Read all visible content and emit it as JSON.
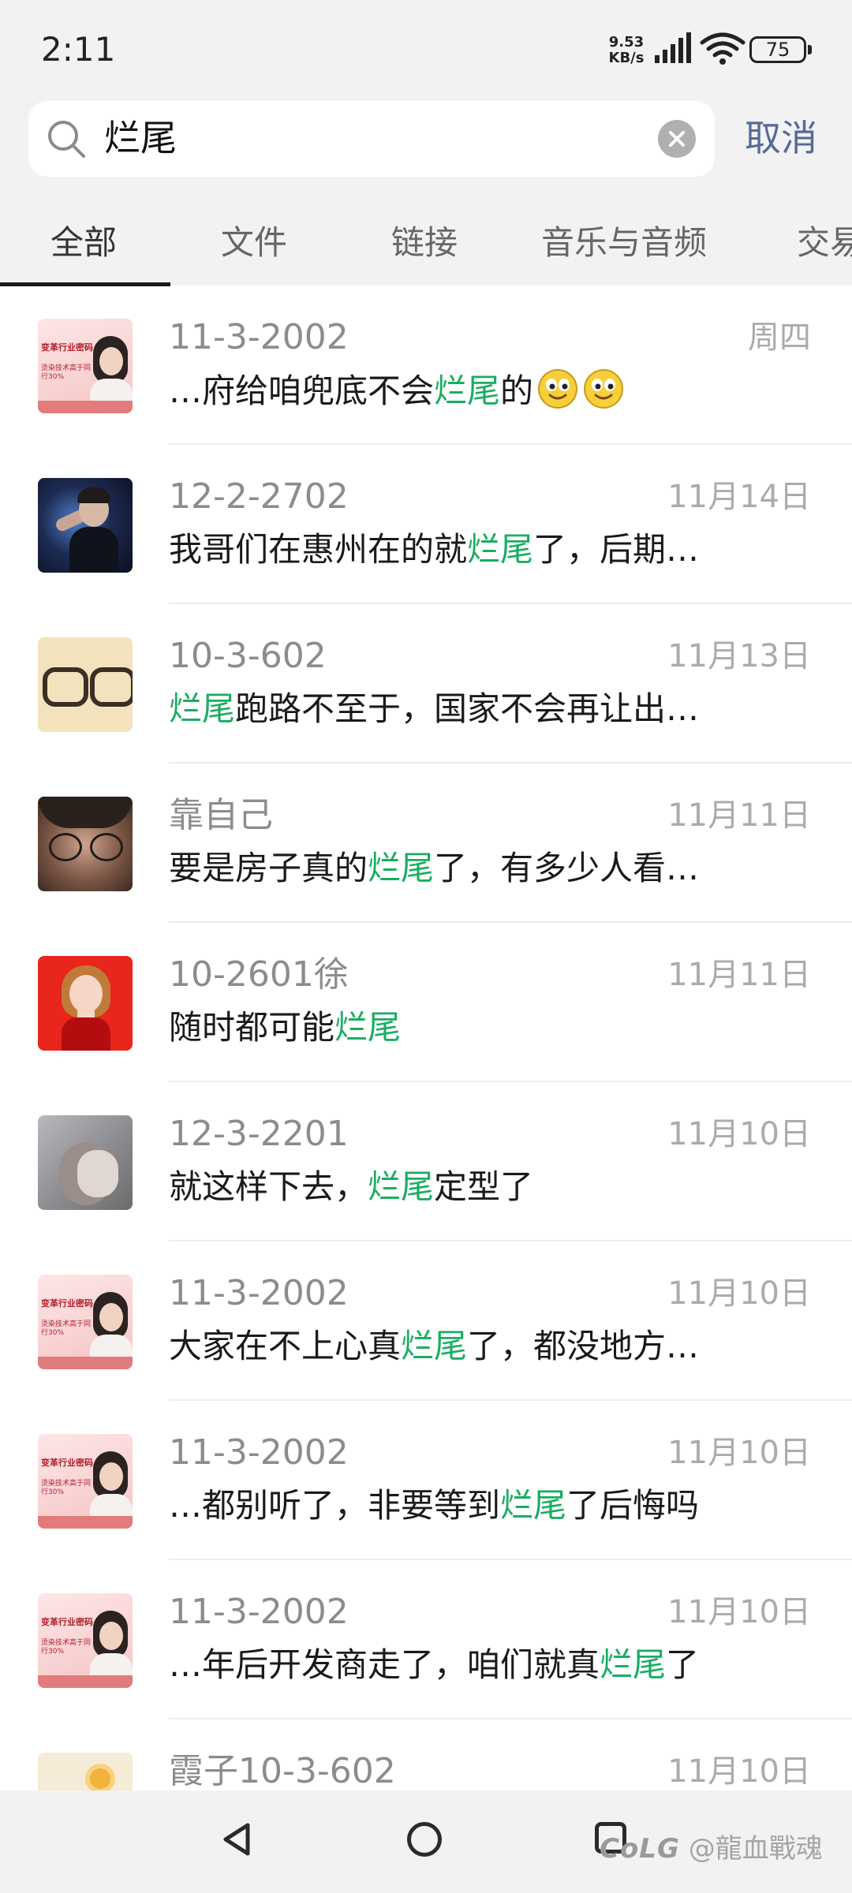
{
  "status_bar": {
    "time": "2:11",
    "network_speed_value": "9.53",
    "network_speed_unit": "KB/s",
    "battery": "75",
    "icons": [
      "signal-icon",
      "wifi-icon",
      "battery-icon"
    ]
  },
  "search": {
    "query": "烂尾",
    "cancel_label": "取消",
    "icons": [
      "search-icon",
      "clear-icon"
    ]
  },
  "tabs": [
    {
      "label": "全部",
      "active": true
    },
    {
      "label": "文件",
      "active": false
    },
    {
      "label": "链接",
      "active": false
    },
    {
      "label": "音乐与音频",
      "active": false
    },
    {
      "label": "交易",
      "active": false
    }
  ],
  "results": [
    {
      "name": "11-3-2002",
      "date": "周四",
      "snippet": {
        "before": "…府给咱兜底不会",
        "highlight": "烂尾",
        "after": "的"
      },
      "emoji_count": 2,
      "avatar": "poster"
    },
    {
      "name": "12-2-2702",
      "date": "11月14日",
      "snippet": {
        "before": "我哥们在惠州在的就",
        "highlight": "烂尾",
        "after": "了，后期…"
      },
      "emoji_count": 0,
      "avatar": "dark"
    },
    {
      "name": "10-3-602",
      "date": "11月13日",
      "snippet": {
        "before": "",
        "highlight": "烂尾",
        "after": "跑路不至于，国家不会再让出…"
      },
      "emoji_count": 0,
      "avatar": "glasses"
    },
    {
      "name": "靠自己",
      "date": "11月11日",
      "snippet": {
        "before": "要是房子真的",
        "highlight": "烂尾",
        "after": "了，有多少人看…"
      },
      "emoji_count": 0,
      "avatar": "face"
    },
    {
      "name": "10-2601徐",
      "date": "11月11日",
      "snippet": {
        "before": "随时都可能",
        "highlight": "烂尾",
        "after": ""
      },
      "emoji_count": 0,
      "avatar": "red"
    },
    {
      "name": "12-3-2201",
      "date": "11月10日",
      "snippet": {
        "before": "就这样下去，",
        "highlight": "烂尾",
        "after": "定型了"
      },
      "emoji_count": 0,
      "avatar": "hood"
    },
    {
      "name": "11-3-2002",
      "date": "11月10日",
      "snippet": {
        "before": "大家在不上心真",
        "highlight": "烂尾",
        "after": "了，都没地方…"
      },
      "emoji_count": 0,
      "avatar": "poster"
    },
    {
      "name": "11-3-2002",
      "date": "11月10日",
      "snippet": {
        "before": "…都别听了，非要等到",
        "highlight": "烂尾",
        "after": "了后悔吗"
      },
      "emoji_count": 0,
      "avatar": "poster"
    },
    {
      "name": "11-3-2002",
      "date": "11月10日",
      "snippet": {
        "before": "…年后开发商走了，咱们就真",
        "highlight": "烂尾",
        "after": "了"
      },
      "emoji_count": 0,
      "avatar": "poster"
    },
    {
      "name": "霞子10-3-602",
      "date": "11月10日",
      "snippet": {
        "before": "",
        "highlight": "",
        "after": ""
      },
      "emoji_count": 0,
      "avatar": "sun"
    }
  ],
  "poster_avatar": {
    "title": "变革行业密码",
    "subtitle": "烫染技术高于同行30%"
  },
  "nav_bar": {
    "icons": [
      "back-icon",
      "home-icon",
      "recents-icon"
    ]
  },
  "watermark": {
    "logo": "CoLG",
    "text": "@龍血戰魂"
  },
  "colors": {
    "highlight": "#1aad62",
    "cancel": "#566a95",
    "background_bar": "#f2f2f2"
  }
}
